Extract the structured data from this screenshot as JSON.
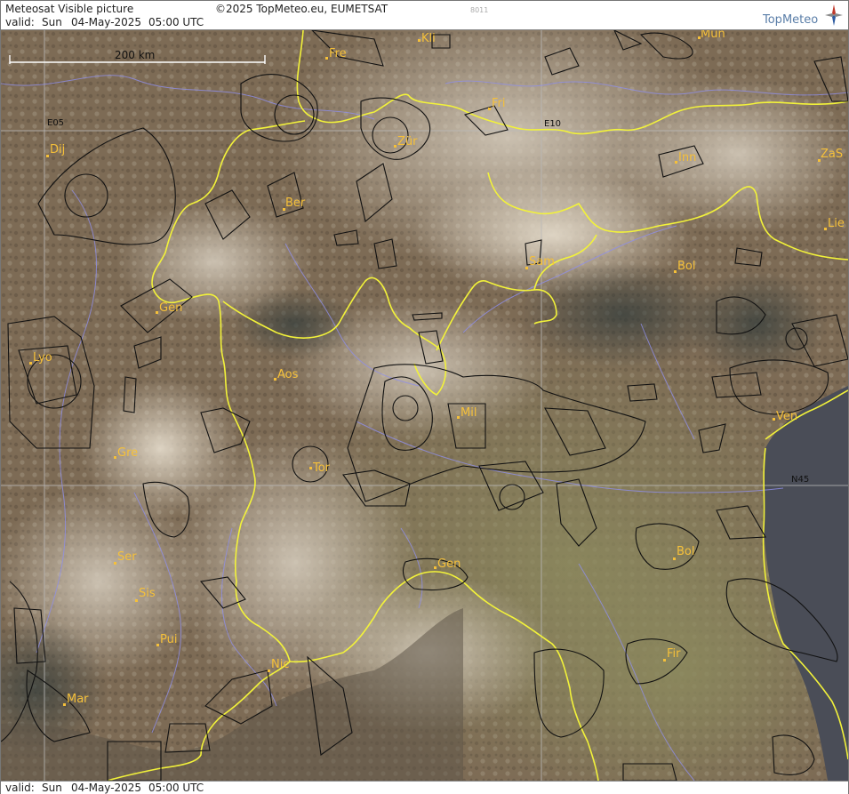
{
  "header": {
    "title": "Meteosat Visible picture",
    "copyright": "©2025 TopMeteo.eu, EUMETSAT",
    "code": "8011",
    "valid_label": "valid:",
    "valid_day": "Sun",
    "valid_date": "04-May-2025",
    "valid_time": "05:00 UTC",
    "logo": "TopMeteo"
  },
  "footer": {
    "valid_label": "valid:",
    "valid_day": "Sun",
    "valid_date": "04-May-2025",
    "valid_time": "05:00 UTC"
  },
  "map": {
    "scale_label": "200 km",
    "grid_labels": {
      "e05": "E05",
      "e10": "E10",
      "n45": "N45"
    },
    "cities": [
      {
        "name": "Kli"
      },
      {
        "name": "Mun"
      },
      {
        "name": "Fre"
      },
      {
        "name": "Fri"
      },
      {
        "name": "Dij"
      },
      {
        "name": "Zür"
      },
      {
        "name": "Inn"
      },
      {
        "name": "ZaS"
      },
      {
        "name": "Ber"
      },
      {
        "name": "Lie"
      },
      {
        "name": "Sam"
      },
      {
        "name": "Bol"
      },
      {
        "name": "Gen"
      },
      {
        "name": "Lyo"
      },
      {
        "name": "Aos"
      },
      {
        "name": "Mil"
      },
      {
        "name": "Ven"
      },
      {
        "name": "Gre"
      },
      {
        "name": "Tor"
      },
      {
        "name": "Ser"
      },
      {
        "name": "Gen"
      },
      {
        "name": "Bol"
      },
      {
        "name": "Sis"
      },
      {
        "name": "Pui"
      },
      {
        "name": "Nic"
      },
      {
        "name": "Fir"
      },
      {
        "name": "Mar"
      }
    ],
    "colors": {
      "border": "#f2f23a",
      "city_label": "#f5c03a",
      "airspace": "#111111",
      "river": "#8f8fe8",
      "sea": "#4a4d57"
    }
  }
}
